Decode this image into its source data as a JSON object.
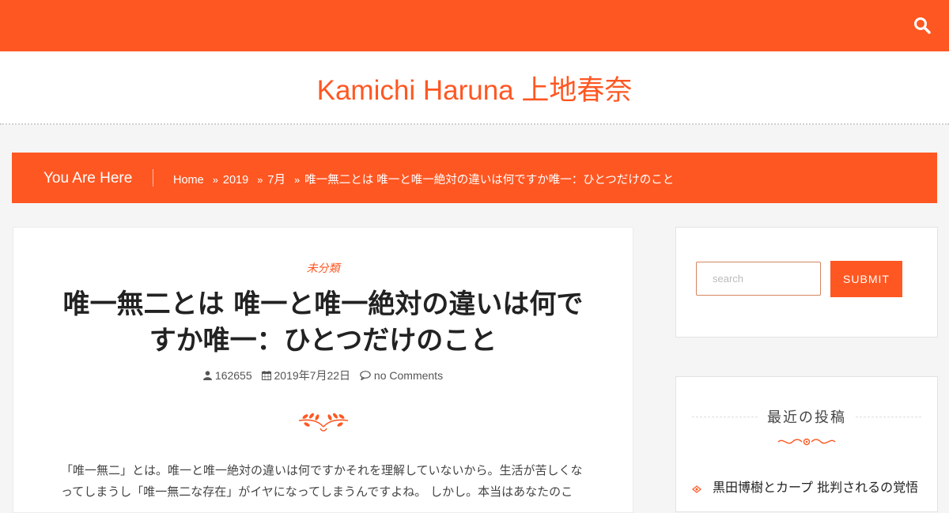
{
  "header": {
    "site_title": "Kamichi Haruna 上地春奈"
  },
  "breadcrumb": {
    "label": "You Are Here",
    "items": [
      "Home",
      "2019",
      "7月",
      "唯一無二とは 唯一と唯一絶対の違いは何ですか唯一：ひとつだけのこと"
    ]
  },
  "post": {
    "category": "未分類",
    "title": "唯一無二とは 唯一と唯一絶対の違いは何ですか唯一：ひとつだけのこと",
    "author": "162655",
    "date": "2019年7月22日",
    "comments": "no Comments",
    "excerpt": "「唯一無二」とは。唯一と唯一絶対の違いは何ですかそれを理解していないから。生活が苦しくなってしまうし「唯一無二な存在」がイヤになってしまうんですよね。 しかし。本当はあなたのこ"
  },
  "sidebar": {
    "search_placeholder": "search",
    "submit_label": "SUBMIT",
    "recent_title": "最近の投稿",
    "recent_posts": [
      "黒田博樹とカープ 批判されるの覚悟"
    ]
  },
  "colors": {
    "accent": "#ff5722",
    "background": "#f5f5f5"
  }
}
